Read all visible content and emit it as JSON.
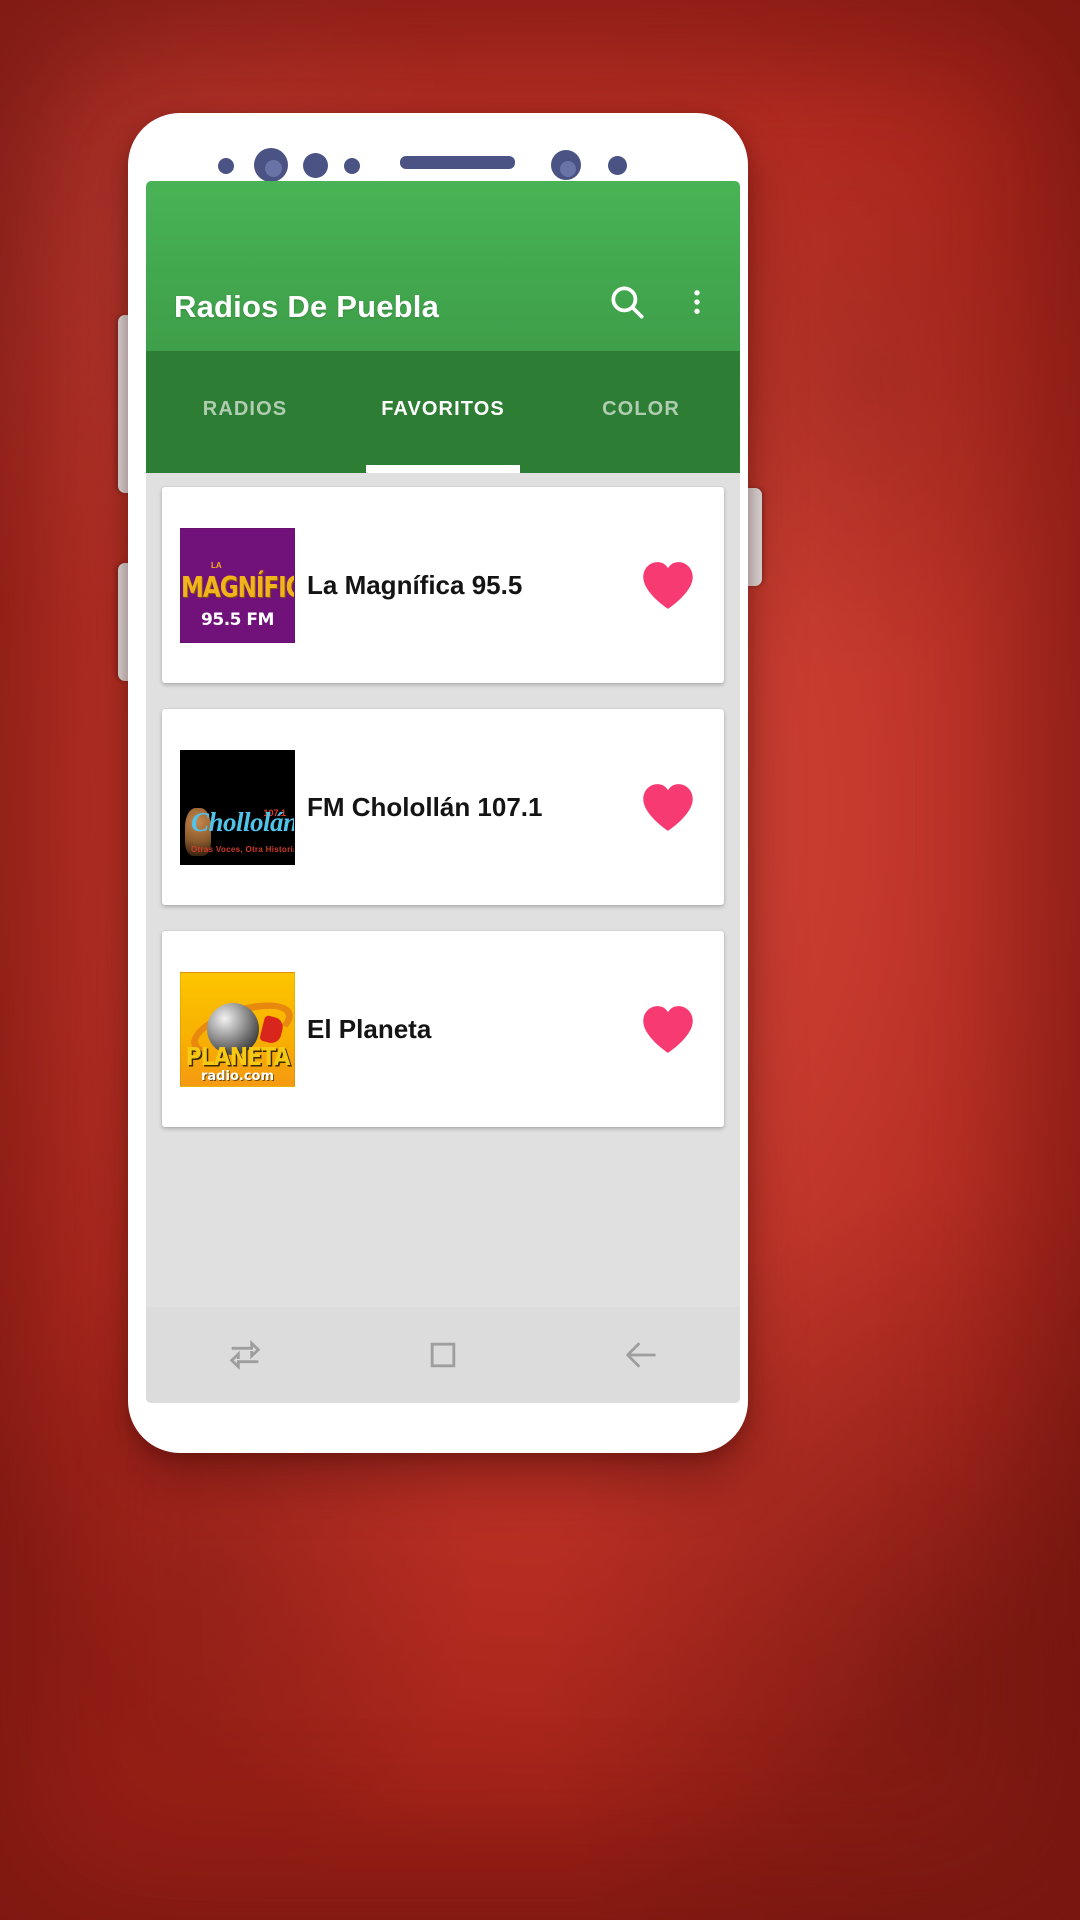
{
  "theme": {
    "background_red": "#c63a2e",
    "appbar_green": "#42a84e",
    "tabbar_green": "#2e7d34",
    "favorite_pink": "#f73b72",
    "list_background": "#e0e0e0",
    "card_white": "#ffffff",
    "sensor_navy": "#4a5384"
  },
  "phone": {
    "sensors": [
      {
        "name": "proximity-sensor-dot"
      },
      {
        "name": "front-camera-lens"
      },
      {
        "name": "iris-sensor-dot"
      },
      {
        "name": "light-sensor-dot"
      },
      {
        "name": "earpiece-speaker"
      },
      {
        "name": "secondary-camera-lens"
      },
      {
        "name": "led-indicator-dot"
      }
    ]
  },
  "appbar": {
    "title": "Radios De Puebla",
    "search_icon": "search-icon",
    "overflow_icon": "more-vert-icon"
  },
  "tabs": {
    "items": [
      {
        "label": "RADIOS",
        "active": false
      },
      {
        "label": "FAVORITOS",
        "active": true
      },
      {
        "label": "COLOR",
        "active": false
      }
    ],
    "active_index": 1
  },
  "list": {
    "items": [
      {
        "name": "La Magnífica 95.5",
        "logo_kind": "lg-magnifica",
        "logo_text_top": "MAGNÍFICA",
        "logo_text_tiny": "LA",
        "logo_text_sub": "95.5 FM",
        "favorite_icon": "heart-filled-icon",
        "favorite": true
      },
      {
        "name": "FM Cholollán 107.1",
        "logo_kind": "lg-chololl",
        "logo_text_top": "Chollolán",
        "logo_text_tiny": "107.1",
        "logo_text_sub": "Otras Voces, Otra Historia",
        "favorite_icon": "heart-filled-icon",
        "favorite": true
      },
      {
        "name": "El Planeta",
        "logo_kind": "lg-planeta",
        "logo_text_top": "PLANETA",
        "logo_text_tiny": "",
        "logo_text_sub": "radio.com",
        "favorite_icon": "heart-filled-icon",
        "favorite": true
      }
    ]
  },
  "navbar": {
    "items": [
      {
        "icon": "recents-icon"
      },
      {
        "icon": "home-square-icon"
      },
      {
        "icon": "back-arrow-icon"
      }
    ]
  }
}
